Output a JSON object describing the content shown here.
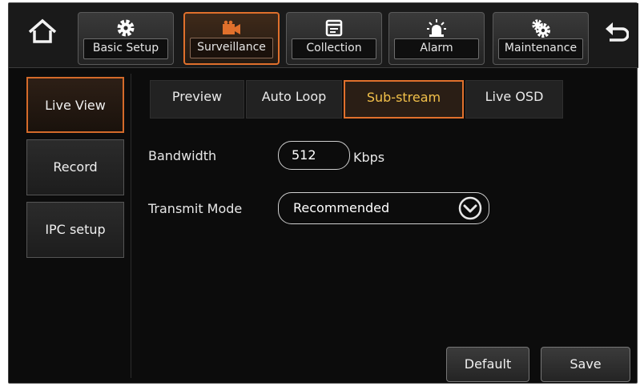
{
  "nav": {
    "home_icon": "home-icon",
    "back_icon": "back-arrow-icon",
    "tabs": [
      {
        "label": "Basic Setup",
        "icon": "gear-icon"
      },
      {
        "label": "Surveillance",
        "icon": "video-camera-icon"
      },
      {
        "label": "Collection",
        "icon": "calendar-icon"
      },
      {
        "label": "Alarm",
        "icon": "alarm-light-icon"
      },
      {
        "label": "Maintenance",
        "icon": "gears-icon"
      }
    ],
    "active_tab": "Surveillance"
  },
  "sidebar": {
    "items": [
      {
        "label": "Live View"
      },
      {
        "label": "Record"
      },
      {
        "label": "IPC setup"
      }
    ],
    "active": "Live View"
  },
  "subtabs": {
    "items": [
      {
        "label": "Preview"
      },
      {
        "label": "Auto Loop"
      },
      {
        "label": "Sub-stream"
      },
      {
        "label": "Live OSD"
      }
    ],
    "active": "Sub-stream"
  },
  "form": {
    "bandwidth_label": "Bandwidth",
    "bandwidth_value": "512",
    "bandwidth_unit": "Kbps",
    "transmit_label": "Transmit Mode",
    "transmit_value": "Recommended"
  },
  "footer": {
    "default_label": "Default",
    "save_label": "Save"
  },
  "colors": {
    "accent": "#e0702c",
    "active_text": "#f3c14a",
    "background": "#0c0c0c"
  }
}
